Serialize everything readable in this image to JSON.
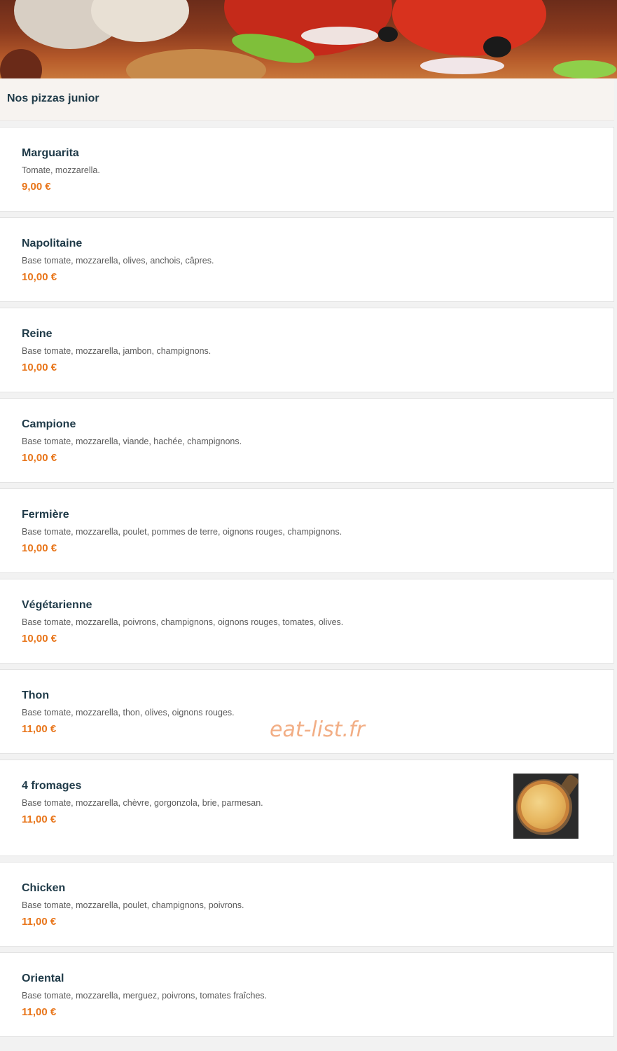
{
  "section": {
    "title": "Nos pizzas junior"
  },
  "items": [
    {
      "name": "Marguarita",
      "desc": "Tomate, mozzarella.",
      "price": "9,00 €"
    },
    {
      "name": "Napolitaine",
      "desc": "Base tomate, mozzarella, olives, anchois, câpres.",
      "price": "10,00 €"
    },
    {
      "name": "Reine",
      "desc": "Base tomate, mozzarella, jambon, champignons.",
      "price": "10,00 €"
    },
    {
      "name": "Campione",
      "desc": "Base tomate, mozzarella, viande, hachée, champignons.",
      "price": "10,00 €"
    },
    {
      "name": "Fermière",
      "desc": "Base tomate, mozzarella, poulet, pommes de terre, oignons rouges, champignons.",
      "price": "10,00 €"
    },
    {
      "name": "Végétarienne",
      "desc": "Base tomate, mozzarella, poivrons, champignons, oignons rouges, tomates, olives.",
      "price": "10,00 €"
    },
    {
      "name": "Thon",
      "desc": "Base tomate, mozzarella, thon, olives, oignons rouges.",
      "price": "11,00 €"
    },
    {
      "name": "4 fromages",
      "desc": "Base tomate, mozzarella, chèvre, gorgonzola, brie, parmesan.",
      "price": "11,00 €"
    },
    {
      "name": "Chicken",
      "desc": "Base tomate, mozzarella, poulet, champignons, poivrons.",
      "price": "11,00 €"
    },
    {
      "name": "Oriental",
      "desc": "Base tomate, mozzarella, merguez, poivrons, tomates fraîches.",
      "price": "11,00 €"
    }
  ],
  "watermark": "eat-list.fr",
  "colors": {
    "title": "#1f3a48",
    "price": "#e8751a",
    "header_bg": "#f7f3f0"
  }
}
